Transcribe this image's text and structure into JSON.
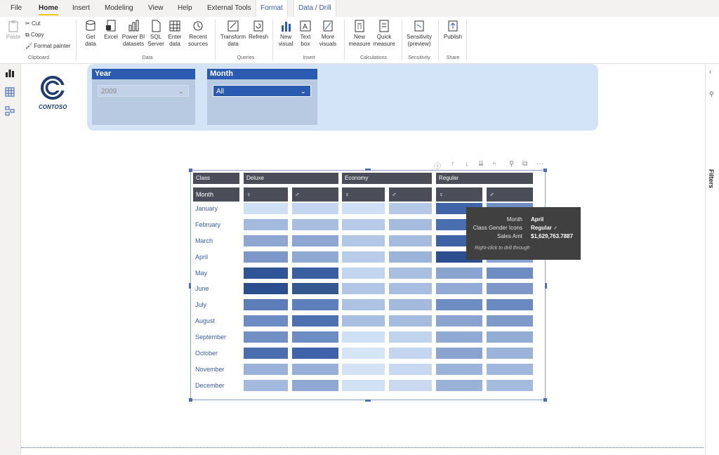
{
  "ribbon": {
    "tabs": [
      "File",
      "Home",
      "Insert",
      "Modeling",
      "View",
      "Help",
      "External Tools",
      "Format",
      "Data / Drill"
    ],
    "active_tab": "Home",
    "clipboard": {
      "paste": "Paste",
      "cut": "Cut",
      "copy": "Copy",
      "format_painter": "Format painter",
      "group": "Clipboard"
    },
    "data": {
      "get_data": "Get data",
      "excel": "Excel",
      "pbi_datasets": "Power BI datasets",
      "sql": "SQL Server",
      "enter": "Enter data",
      "recent": "Recent sources",
      "group": "Data"
    },
    "queries": {
      "transform": "Transform data",
      "refresh": "Refresh",
      "group": "Queries"
    },
    "insert": {
      "new_visual": "New visual",
      "text_box": "Text box",
      "more_visuals": "More visuals",
      "group": "Insert"
    },
    "calculations": {
      "new_measure": "New measure",
      "quick_measure": "Quick measure",
      "group": "Calculations"
    },
    "sensitivity": {
      "label": "Sensitivity (preview)",
      "group": "Sensitivity"
    },
    "share": {
      "publish": "Publish",
      "group": "Share"
    }
  },
  "logo_text": "CONTOSO",
  "filters_label": "Filters",
  "slicers": {
    "year": {
      "title": "Year",
      "value": "2009"
    },
    "month": {
      "title": "Month",
      "value": "All"
    }
  },
  "matrix": {
    "class_header": "Class",
    "month_header": "Month",
    "classes": [
      "Deluxe",
      "Economy",
      "Regular"
    ],
    "gender_icons": [
      "♀",
      "♂",
      "♀",
      "♂",
      "♀",
      "♂"
    ],
    "months": [
      "January",
      "February",
      "March",
      "April",
      "May",
      "June",
      "July",
      "August",
      "September",
      "October",
      "November",
      "December"
    ],
    "cell_colors": [
      [
        "#cfe0f4",
        "#c4d6ef",
        "#cfe0f4",
        "#b5c8e6",
        "#3f65a8",
        "#6f8ec4"
      ],
      [
        "#a3b9dd",
        "#a9bedf",
        "#b7cbe8",
        "#a6bcdf",
        "#4a6fb0",
        "#6f8ec4"
      ],
      [
        "#8ea7d2",
        "#8da6d2",
        "#b2c6e6",
        "#a6bcdf",
        "#3e63a5",
        "#5b7fbd"
      ],
      [
        "#7e99c9",
        "#90a9d3",
        "#b9cce8",
        "#9cb3da",
        "#2e4f8f",
        "#8aa4d0"
      ],
      [
        "#2f5597",
        "#3a5fa0",
        "#c3d5ee",
        "#a9bfe0",
        "#8aa4d0",
        "#6e8dc3"
      ],
      [
        "#2b4f8e",
        "#34578f",
        "#b2c6e6",
        "#a8bde0",
        "#92abd4",
        "#7d98c8"
      ],
      [
        "#5c7db8",
        "#5d7fbb",
        "#aec3e4",
        "#a3badd",
        "#6e8dc3",
        "#6a8ac1"
      ],
      [
        "#6c8cc3",
        "#4d70b0",
        "#a8bfe1",
        "#a6bcdf",
        "#8aa4cf",
        "#7e9ac9"
      ],
      [
        "#7390c4",
        "#6e8dc3",
        "#cfe0f4",
        "#c0d3ed",
        "#91aad3",
        "#93acd4"
      ],
      [
        "#4b6fae",
        "#3f63a9",
        "#d6e5f6",
        "#c4d6ef",
        "#8aa4cf",
        "#9bb2d9"
      ],
      [
        "#9ab2d9",
        "#98b0d8",
        "#d3e3f5",
        "#c7d8f0",
        "#9bb2d9",
        "#a0b6dc"
      ],
      [
        "#a3b9dd",
        "#8fa8d3",
        "#d0e1f4",
        "#cad9f0",
        "#9ab1d8",
        "#a5bbde"
      ]
    ]
  },
  "tooltip": {
    "rows": [
      {
        "k": "Month",
        "v": "April"
      },
      {
        "k": "Class Gender Icons",
        "v": "Regular ♂"
      },
      {
        "k": "Sales Amt",
        "v": "$1,629,763.7887"
      }
    ],
    "footer": "Right-click to drill through"
  }
}
